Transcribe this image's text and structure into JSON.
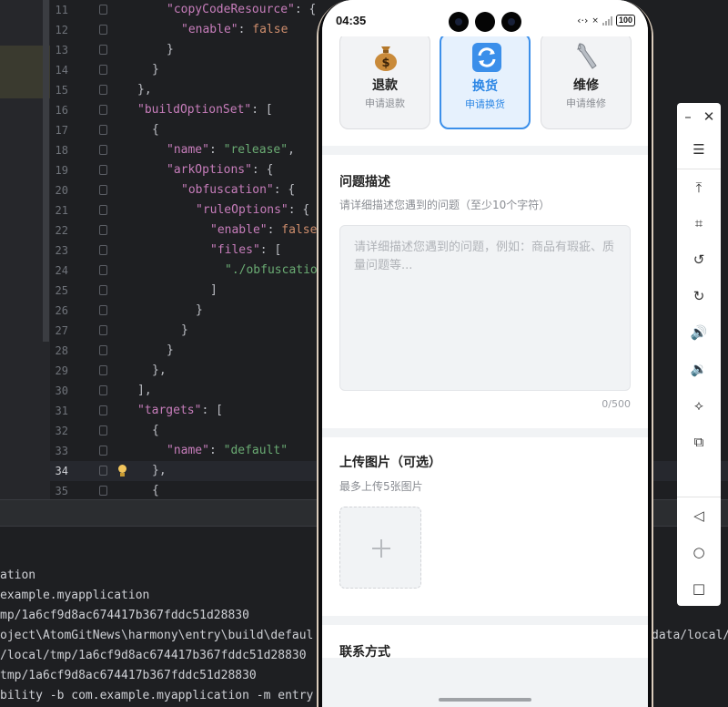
{
  "editor": {
    "lines": [
      {
        "n": "11",
        "html": "<span class='k'>\"copyCodeResource\"</span>: {",
        "indent": 88
      },
      {
        "n": "12",
        "html": "<span class='k'>\"enable\"</span>: <span class='kw'>false</span>",
        "indent": 104
      },
      {
        "n": "13",
        "html": "}",
        "indent": 88
      },
      {
        "n": "14",
        "html": "}",
        "indent": 72
      },
      {
        "n": "15",
        "html": "},",
        "indent": 56
      },
      {
        "n": "16",
        "html": "<span class='k'>\"buildOptionSet\"</span>: [",
        "indent": 56
      },
      {
        "n": "17",
        "html": "{",
        "indent": 72
      },
      {
        "n": "18",
        "html": "<span class='k'>\"name\"</span>: <span class='s'>\"release\"</span>,",
        "indent": 88
      },
      {
        "n": "19",
        "html": "<span class='k'>\"arkOptions\"</span>: {",
        "indent": 88
      },
      {
        "n": "20",
        "html": "<span class='k'>\"obfuscation\"</span>: {",
        "indent": 104
      },
      {
        "n": "21",
        "html": "<span class='k'>\"ruleOptions\"</span>: {",
        "indent": 120
      },
      {
        "n": "22",
        "html": "<span class='k'>\"enable\"</span>: <span class='kw'>false</span>,",
        "indent": 136
      },
      {
        "n": "23",
        "html": "<span class='k'>\"files\"</span>: [",
        "indent": 136
      },
      {
        "n": "24",
        "html": "<span class='s'>\"./obfuscation-</span>",
        "indent": 152
      },
      {
        "n": "25",
        "html": "]",
        "indent": 136
      },
      {
        "n": "26",
        "html": "}",
        "indent": 120
      },
      {
        "n": "27",
        "html": "}",
        "indent": 104
      },
      {
        "n": "28",
        "html": "}",
        "indent": 88
      },
      {
        "n": "29",
        "html": "},",
        "indent": 72
      },
      {
        "n": "30",
        "html": "],",
        "indent": 56
      },
      {
        "n": "31",
        "html": "<span class='k'>\"targets\"</span>: [",
        "indent": 56
      },
      {
        "n": "32",
        "html": "{",
        "indent": 72
      },
      {
        "n": "33",
        "html": "<span class='k'>\"name\"</span>: <span class='s'>\"default\"</span>",
        "indent": 88
      },
      {
        "n": "34",
        "html": "},",
        "indent": 72,
        "active": true
      },
      {
        "n": "35",
        "html": "{",
        "indent": 72
      }
    ]
  },
  "console": {
    "lines": [
      "ation",
      "example.myapplication",
      "mp/1a6cf9d8ac674417b367fddc51d28830",
      "oject\\AtomGitNews\\harmony\\entry\\build\\defaul",
      "/local/tmp/1a6cf9d8ac674417b367fddc51d28830",
      "tmp/1a6cf9d8ac674417b367fddc51d28830",
      "bility -b com.example.myapplication -m entry"
    ],
    "right_fragment": "data/local/"
  },
  "phone": {
    "status": {
      "time": "04:35",
      "battery": "100"
    },
    "service_options": [
      {
        "title": "退款",
        "subtitle": "申请退款",
        "icon": "money-bag-icon",
        "selected": false
      },
      {
        "title": "换货",
        "subtitle": "申请换货",
        "icon": "exchange-icon",
        "selected": true
      },
      {
        "title": "维修",
        "subtitle": "申请维修",
        "icon": "wrench-icon",
        "selected": false
      }
    ],
    "description": {
      "title": "问题描述",
      "hint": "请详细描述您遇到的问题（至少10个字符）",
      "placeholder": "请详细描述您遇到的问题，例如：商品有瑕疵、质量问题等...",
      "counter": "0/500"
    },
    "upload": {
      "title": "上传图片（可选）",
      "hint": "最多上传5张图片"
    },
    "contact": {
      "title": "联系方式"
    }
  },
  "toolbar": {
    "buttons": [
      "minimize-icon",
      "close-icon",
      "menu-icon",
      "pin-top-icon",
      "crop-icon",
      "rotate-left-icon",
      "rotate-right-icon",
      "volume-up-icon",
      "volume-down-icon",
      "shake-icon",
      "multi-screen-icon",
      "back-icon",
      "home-icon",
      "recent-apps-icon"
    ]
  }
}
